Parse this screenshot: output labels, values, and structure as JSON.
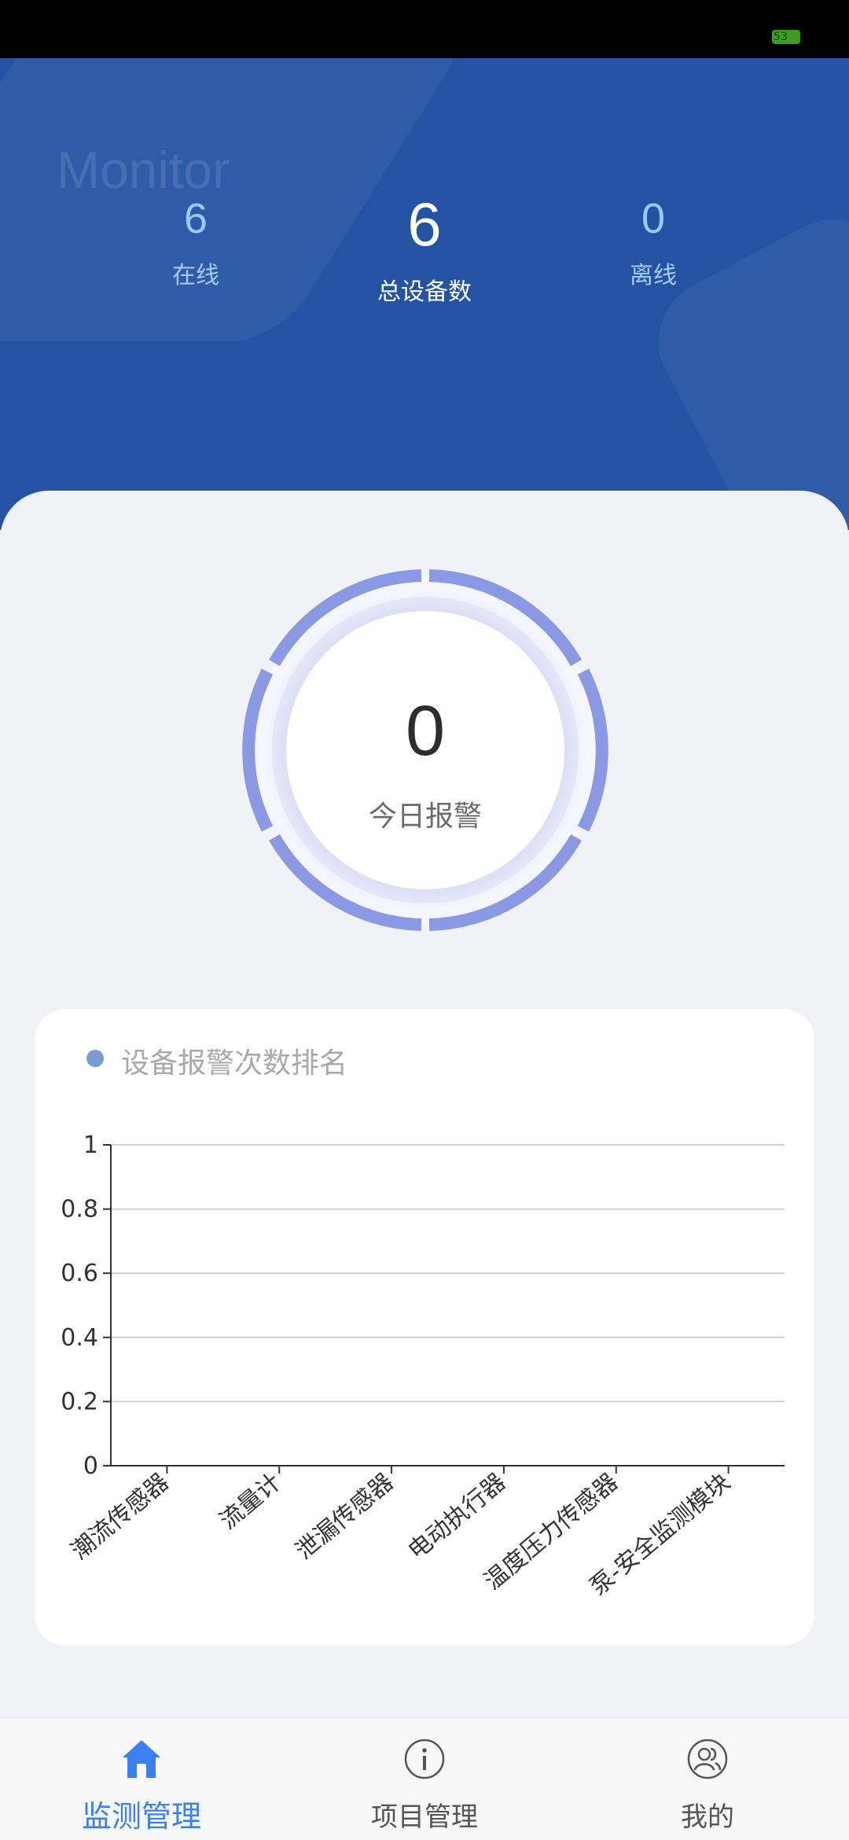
{
  "status_bar": {
    "battery_level": "53"
  },
  "header": {
    "watermark": "Monitor",
    "stats": [
      {
        "value": "6",
        "label": "在线"
      },
      {
        "value": "6",
        "label": "总设备数"
      },
      {
        "value": "0",
        "label": "离线"
      }
    ]
  },
  "alarm": {
    "value": "0",
    "label": "今日报警"
  },
  "ranking_card": {
    "title": "设备报警次数排名"
  },
  "chart_data": {
    "type": "bar",
    "categories": [
      "潮流传感器",
      "流量计",
      "泄漏传感器",
      "电动执行器",
      "温度压力传感器",
      "泵-安全监测模块"
    ],
    "series": [
      {
        "values": [
          0,
          0,
          0,
          0,
          0,
          0
        ]
      }
    ],
    "ylim": [
      0,
      1
    ],
    "yticks": [
      "0",
      "0.2",
      "0.4",
      "0.6",
      "0.8",
      "1"
    ],
    "grid": true
  },
  "tabbar": {
    "tabs": [
      {
        "label": "监测管理",
        "icon": "home-icon",
        "active": true
      },
      {
        "label": "项目管理",
        "icon": "info-icon",
        "active": false
      },
      {
        "label": "我的",
        "icon": "user-icon",
        "active": false
      }
    ]
  },
  "colors": {
    "header_bg": "#2553a3",
    "accent": "#3b7ff0",
    "ring": "#8b98e3"
  }
}
